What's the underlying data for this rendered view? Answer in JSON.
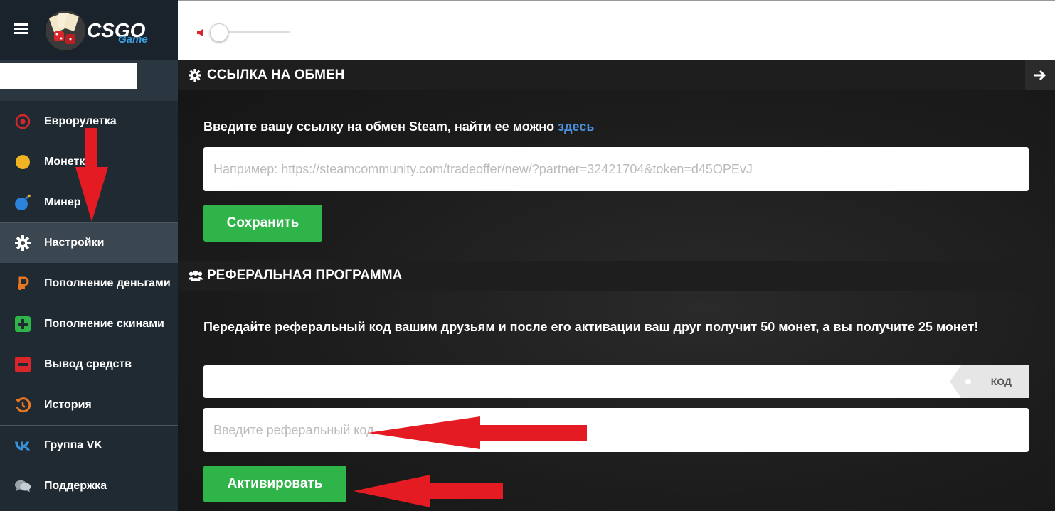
{
  "sidebar": {
    "logo_text": "CSGO",
    "logo_sub": "Game",
    "items": [
      {
        "label": "Еврорулетка",
        "icon": "target-icon"
      },
      {
        "label": "Монетка",
        "icon": "coin-icon"
      },
      {
        "label": "Минер",
        "icon": "bomb-icon"
      },
      {
        "label": "Настройки",
        "icon": "gear-icon"
      },
      {
        "label": "Пополнение деньгами",
        "icon": "ruble-icon"
      },
      {
        "label": "Пополнение скинами",
        "icon": "plus-icon"
      },
      {
        "label": "Вывод средств",
        "icon": "minus-icon"
      },
      {
        "label": "История",
        "icon": "history-icon"
      },
      {
        "label": "Группа VK",
        "icon": "vk-icon"
      },
      {
        "label": "Поддержка",
        "icon": "chat-icon"
      }
    ]
  },
  "trade": {
    "heading": "ССЫЛКА НА ОБМЕН",
    "label": "Введите вашу ссылку на обмен Steam, найти ее можно ",
    "link": "здесь",
    "placeholder": "Например: https://steamcommunity.com/tradeoffer/new/?partner=32421704&token=d45OPEvJ",
    "save": "Сохранить"
  },
  "referral": {
    "heading": "РЕФЕРАЛЬНАЯ ПРОГРАММА",
    "text": "Передайте реферальный код вашим друзьям и после его активации ваш друг получит 50 монет, а вы получите 25 монет!",
    "code_tag": "КОД",
    "code_value": "",
    "placeholder": "Введите реферальный код",
    "activate": "Активировать"
  },
  "colors": {
    "accent_green": "#2fb44a",
    "link_blue": "#4b8fdb",
    "sidebar_bg": "#1f2a33",
    "annotation_red": "#e41b23"
  }
}
